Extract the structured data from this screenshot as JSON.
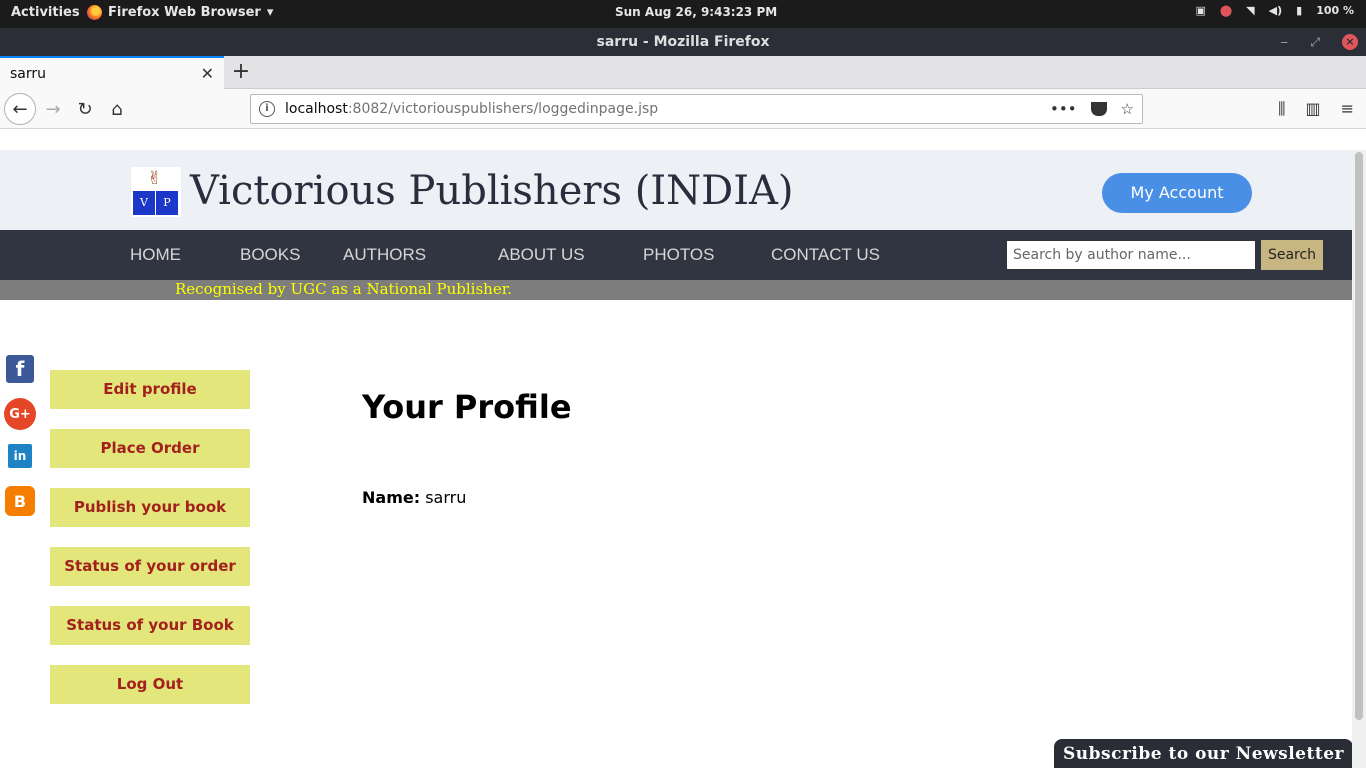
{
  "system_bar": {
    "activities": "Activities",
    "app_name": "Firefox Web Browser",
    "clock": "Sun Aug 26,  9:43:23 PM",
    "battery": "100 %"
  },
  "window": {
    "title": "sarru - Mozilla Firefox"
  },
  "tabs": [
    {
      "title": "sarru"
    }
  ],
  "address_bar": {
    "host": "localhost",
    "path": ":8082/victoriouspublishers/loggedinpage.jsp"
  },
  "site": {
    "title": "Victorious Publishers (INDIA)",
    "logo_letters": [
      "V",
      "P"
    ],
    "my_account": "My Account",
    "nav": [
      "HOME",
      "BOOKS",
      "AUTHORS",
      "ABOUT US",
      "PHOTOS",
      "CONTACT US"
    ],
    "search_placeholder": "Search by author name...",
    "search_button": "Search",
    "tagline": "Recognised by UGC as a National Publisher."
  },
  "social_icons": [
    "facebook-icon",
    "google-plus-icon",
    "linkedin-icon",
    "blogger-icon"
  ],
  "sidebar_menu": [
    "Edit profile",
    "Place Order",
    "Publish your book",
    "Status of your order",
    "Status of your Book",
    "Log Out"
  ],
  "profile": {
    "heading": "Your Profile",
    "name_label": "Name:",
    "name_value": "sarru"
  },
  "newsletter": "Subscribe to our Newsletter"
}
